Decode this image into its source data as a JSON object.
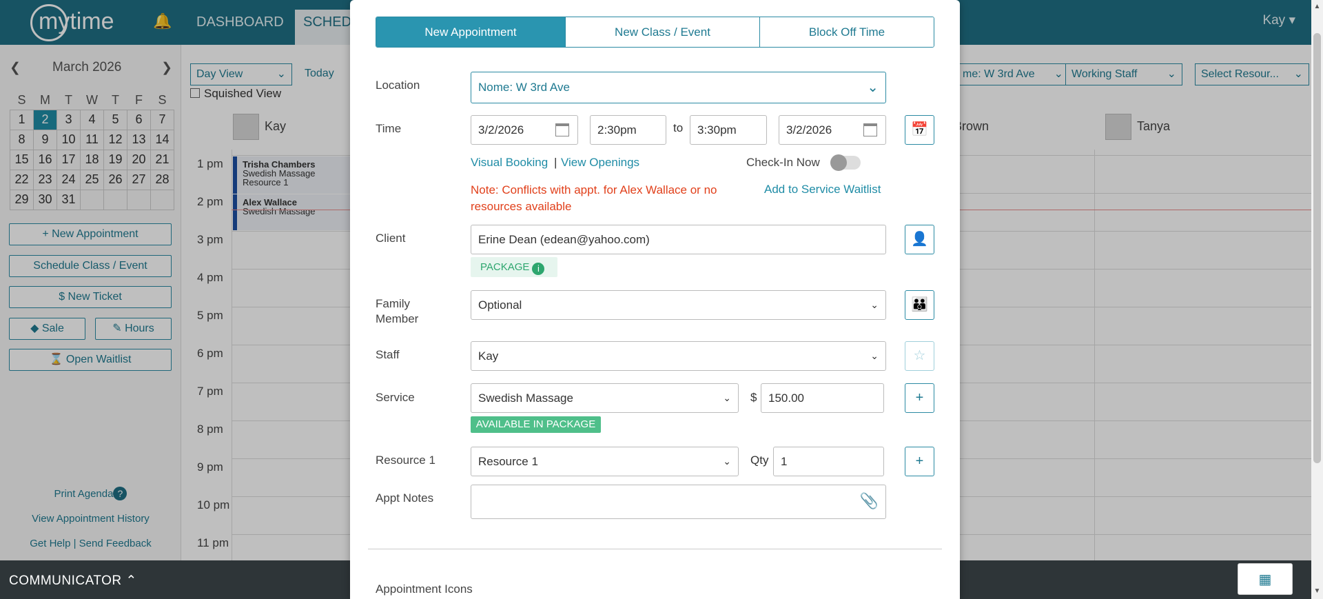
{
  "app": {
    "logo_text": "mytime",
    "nav": {
      "dashboard": "DASHBOARD",
      "schedule": "SCHED"
    },
    "user": "Kay ▾"
  },
  "sidebar": {
    "month_title": "March 2026",
    "dow": [
      "S",
      "M",
      "T",
      "W",
      "T",
      "F",
      "S"
    ],
    "weeks": [
      [
        "1",
        "2",
        "3",
        "4",
        "5",
        "6",
        "7"
      ],
      [
        "8",
        "9",
        "10",
        "11",
        "12",
        "13",
        "14"
      ],
      [
        "15",
        "16",
        "17",
        "18",
        "19",
        "20",
        "21"
      ],
      [
        "22",
        "23",
        "24",
        "25",
        "26",
        "27",
        "28"
      ],
      [
        "29",
        "30",
        "31",
        "",
        "",
        "",
        ""
      ]
    ],
    "today": "2",
    "buttons": {
      "new_appt": "+ New Appointment",
      "schedule_class": "Schedule Class / Event",
      "new_ticket": "$  New Ticket",
      "sale": "Sale",
      "hours": "Hours",
      "open_waitlist": "Open Waitlist"
    },
    "links": {
      "print_agenda": "Print Agenda",
      "view_history": "View Appointment History",
      "get_help": "Get Help",
      "send_feedback": "Send Feedback"
    }
  },
  "calendar": {
    "view_select": "Day View",
    "today_btn": "Today",
    "squished_label": "Squished View",
    "location_filter": "me: W 3rd Ave",
    "staff_filter": "Working Staff",
    "resource_filter": "Select Resour...",
    "staff": [
      "Kay",
      "Brown",
      "Tanya"
    ],
    "hours": [
      "1 pm",
      "2 pm",
      "3 pm",
      "4 pm",
      "5 pm",
      "6 pm",
      "7 pm",
      "8 pm",
      "9 pm",
      "10 pm",
      "11 pm"
    ],
    "appointments": [
      {
        "client": "Trisha Chambers",
        "service": "Swedish Massage",
        "resource": "Resource 1"
      },
      {
        "client": "Alex Wallace",
        "service": "Swedish Massage",
        "resource": ""
      }
    ]
  },
  "communicator": {
    "label": "COMMUNICATOR"
  },
  "modal": {
    "tabs": [
      "New Appointment",
      "New Class / Event",
      "Block Off Time"
    ],
    "active_tab": "New Appointment",
    "location": {
      "label": "Location",
      "value": "Nome: W 3rd Ave"
    },
    "time": {
      "label": "Time",
      "start_date": "3/2/2026",
      "start_time": "2:30pm",
      "to": "to",
      "end_time": "3:30pm",
      "end_date": "3/2/2026"
    },
    "visual_booking": "Visual Booking",
    "view_openings": "View Openings",
    "separator": "|",
    "check_in_label": "Check-In Now",
    "check_in_on": false,
    "conflict_note": "Note: Conflicts with appt. for Alex Wallace or no resources available",
    "add_waitlist": "Add to Service Waitlist",
    "client": {
      "label": "Client",
      "value": "Erine Dean (edean@yahoo.com)",
      "badge": "PACKAGE"
    },
    "family": {
      "label": "Family Member",
      "value": "Optional"
    },
    "staff": {
      "label": "Staff",
      "value": "Kay"
    },
    "service": {
      "label": "Service",
      "value": "Swedish Massage",
      "currency": "$",
      "price": "150.00",
      "badge": "AVAILABLE IN PACKAGE"
    },
    "resource": {
      "label": "Resource 1",
      "value": "Resource 1",
      "qty_label": "Qty",
      "qty": "1"
    },
    "notes": {
      "label": "Appt Notes",
      "value": ""
    },
    "icons_section": "Appointment Icons"
  },
  "colors": {
    "brand": "#1f6f84",
    "accent": "#2a95b0",
    "error": "#e1401b",
    "success": "#4fbf8a"
  }
}
